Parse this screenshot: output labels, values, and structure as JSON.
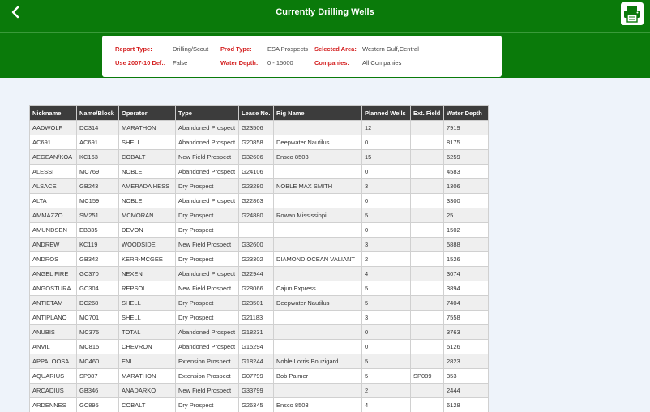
{
  "header": {
    "title": "Currently Drilling Wells",
    "back_icon": "chevron-left-icon",
    "print_icon": "printer-icon",
    "bg_color": "#0a7a0a"
  },
  "filters": {
    "report_type": {
      "label": "Report Type:",
      "value": "Drilling/Scout"
    },
    "use_def": {
      "label": "Use 2007-10 Def.:",
      "value": "False"
    },
    "prod_type": {
      "label": "Prod Type:",
      "value": "ESA Prospects"
    },
    "water_depth": {
      "label": "Water Depth:",
      "value": "0 - 15000"
    },
    "selected_area": {
      "label": "Selected Area:",
      "value": "Western Gulf,Central"
    },
    "companies": {
      "label": "Companies:",
      "value": "All Companies"
    }
  },
  "table": {
    "columns": [
      "Nickname",
      "Name/Block",
      "Operator",
      "Type",
      "Lease No.",
      "Rig Name",
      "Planned Wells",
      "Ext. Field",
      "Water Depth"
    ],
    "rows": [
      [
        "AADWOLF",
        "DC314",
        "MARATHON",
        "Abandoned Prospect",
        "G23506",
        "",
        "12",
        "",
        "7919"
      ],
      [
        "AC691",
        "AC691",
        "SHELL",
        "Abandoned Prospect",
        "G20858",
        "Deepwater Nautilus",
        "0",
        "",
        "8175"
      ],
      [
        "AEGEAN/KOA",
        "KC163",
        "COBALT",
        "New Field Prospect",
        "G32606",
        "Ensco 8503",
        "15",
        "",
        "6259"
      ],
      [
        "ALESSI",
        "MC769",
        "NOBLE",
        "Abandoned Prospect",
        "G24106",
        "",
        "0",
        "",
        "4583"
      ],
      [
        "ALSACE",
        "GB243",
        "AMERADA HESS",
        "Dry Prospect",
        "G23280",
        "NOBLE MAX SMITH",
        "3",
        "",
        "1306"
      ],
      [
        "ALTA",
        "MC159",
        "NOBLE",
        "Abandoned Prospect",
        "G22863",
        "",
        "0",
        "",
        "3300"
      ],
      [
        "AMMAZZO",
        "SM251",
        "MCMORAN",
        "Dry Prospect",
        "G24880",
        "Rowan Mississippi",
        "5",
        "",
        "25"
      ],
      [
        "AMUNDSEN",
        "EB335",
        "DEVON",
        "Dry Prospect",
        "",
        "",
        "0",
        "",
        "1502"
      ],
      [
        "ANDREW",
        "KC119",
        "WOODSIDE",
        "New Field Prospect",
        "G32600",
        "",
        "3",
        "",
        "5888"
      ],
      [
        "ANDROS",
        "GB342",
        "KERR-MCGEE",
        "Dry Prospect",
        "G23302",
        "DIAMOND OCEAN VALIANT",
        "2",
        "",
        "1526"
      ],
      [
        "ANGEL FIRE",
        "GC370",
        "NEXEN",
        "Abandoned Prospect",
        "G22944",
        "",
        "4",
        "",
        "3074"
      ],
      [
        "ANGOSTURA",
        "GC304",
        "REPSOL",
        "New Field Prospect",
        "G28066",
        "Cajun Express",
        "5",
        "",
        "3894"
      ],
      [
        "ANTIETAM",
        "DC268",
        "SHELL",
        "Dry Prospect",
        "G23501",
        "Deepwater Nautilus",
        "5",
        "",
        "7404"
      ],
      [
        "ANTIPLANO",
        "MC701",
        "SHELL",
        "Dry Prospect",
        "G21183",
        "",
        "3",
        "",
        "7558"
      ],
      [
        "ANUBIS",
        "MC375",
        "TOTAL",
        "Abandoned Prospect",
        "G18231",
        "",
        "0",
        "",
        "3763"
      ],
      [
        "ANVIL",
        "MC815",
        "CHEVRON",
        "Abandoned Prospect",
        "G15294",
        "",
        "0",
        "",
        "5126"
      ],
      [
        "APPALOOSA",
        "MC460",
        "ENI",
        "Extension Prospect",
        "G18244",
        "Noble Lorris Bouzigard",
        "5",
        "",
        "2823"
      ],
      [
        "AQUARIUS",
        "SP087",
        "MARATHON",
        "Extension Prospect",
        "G07799",
        "Bob Palmer",
        "5",
        "SP089",
        "353"
      ],
      [
        "ARCADIUS",
        "GB346",
        "ANADARKO",
        "New Field Prospect",
        "G33799",
        "",
        "2",
        "",
        "2444"
      ],
      [
        "ARDENNES",
        "GC895",
        "COBALT",
        "Dry Prospect",
        "G26345",
        "Ensco 8503",
        "4",
        "",
        "6128"
      ]
    ]
  }
}
